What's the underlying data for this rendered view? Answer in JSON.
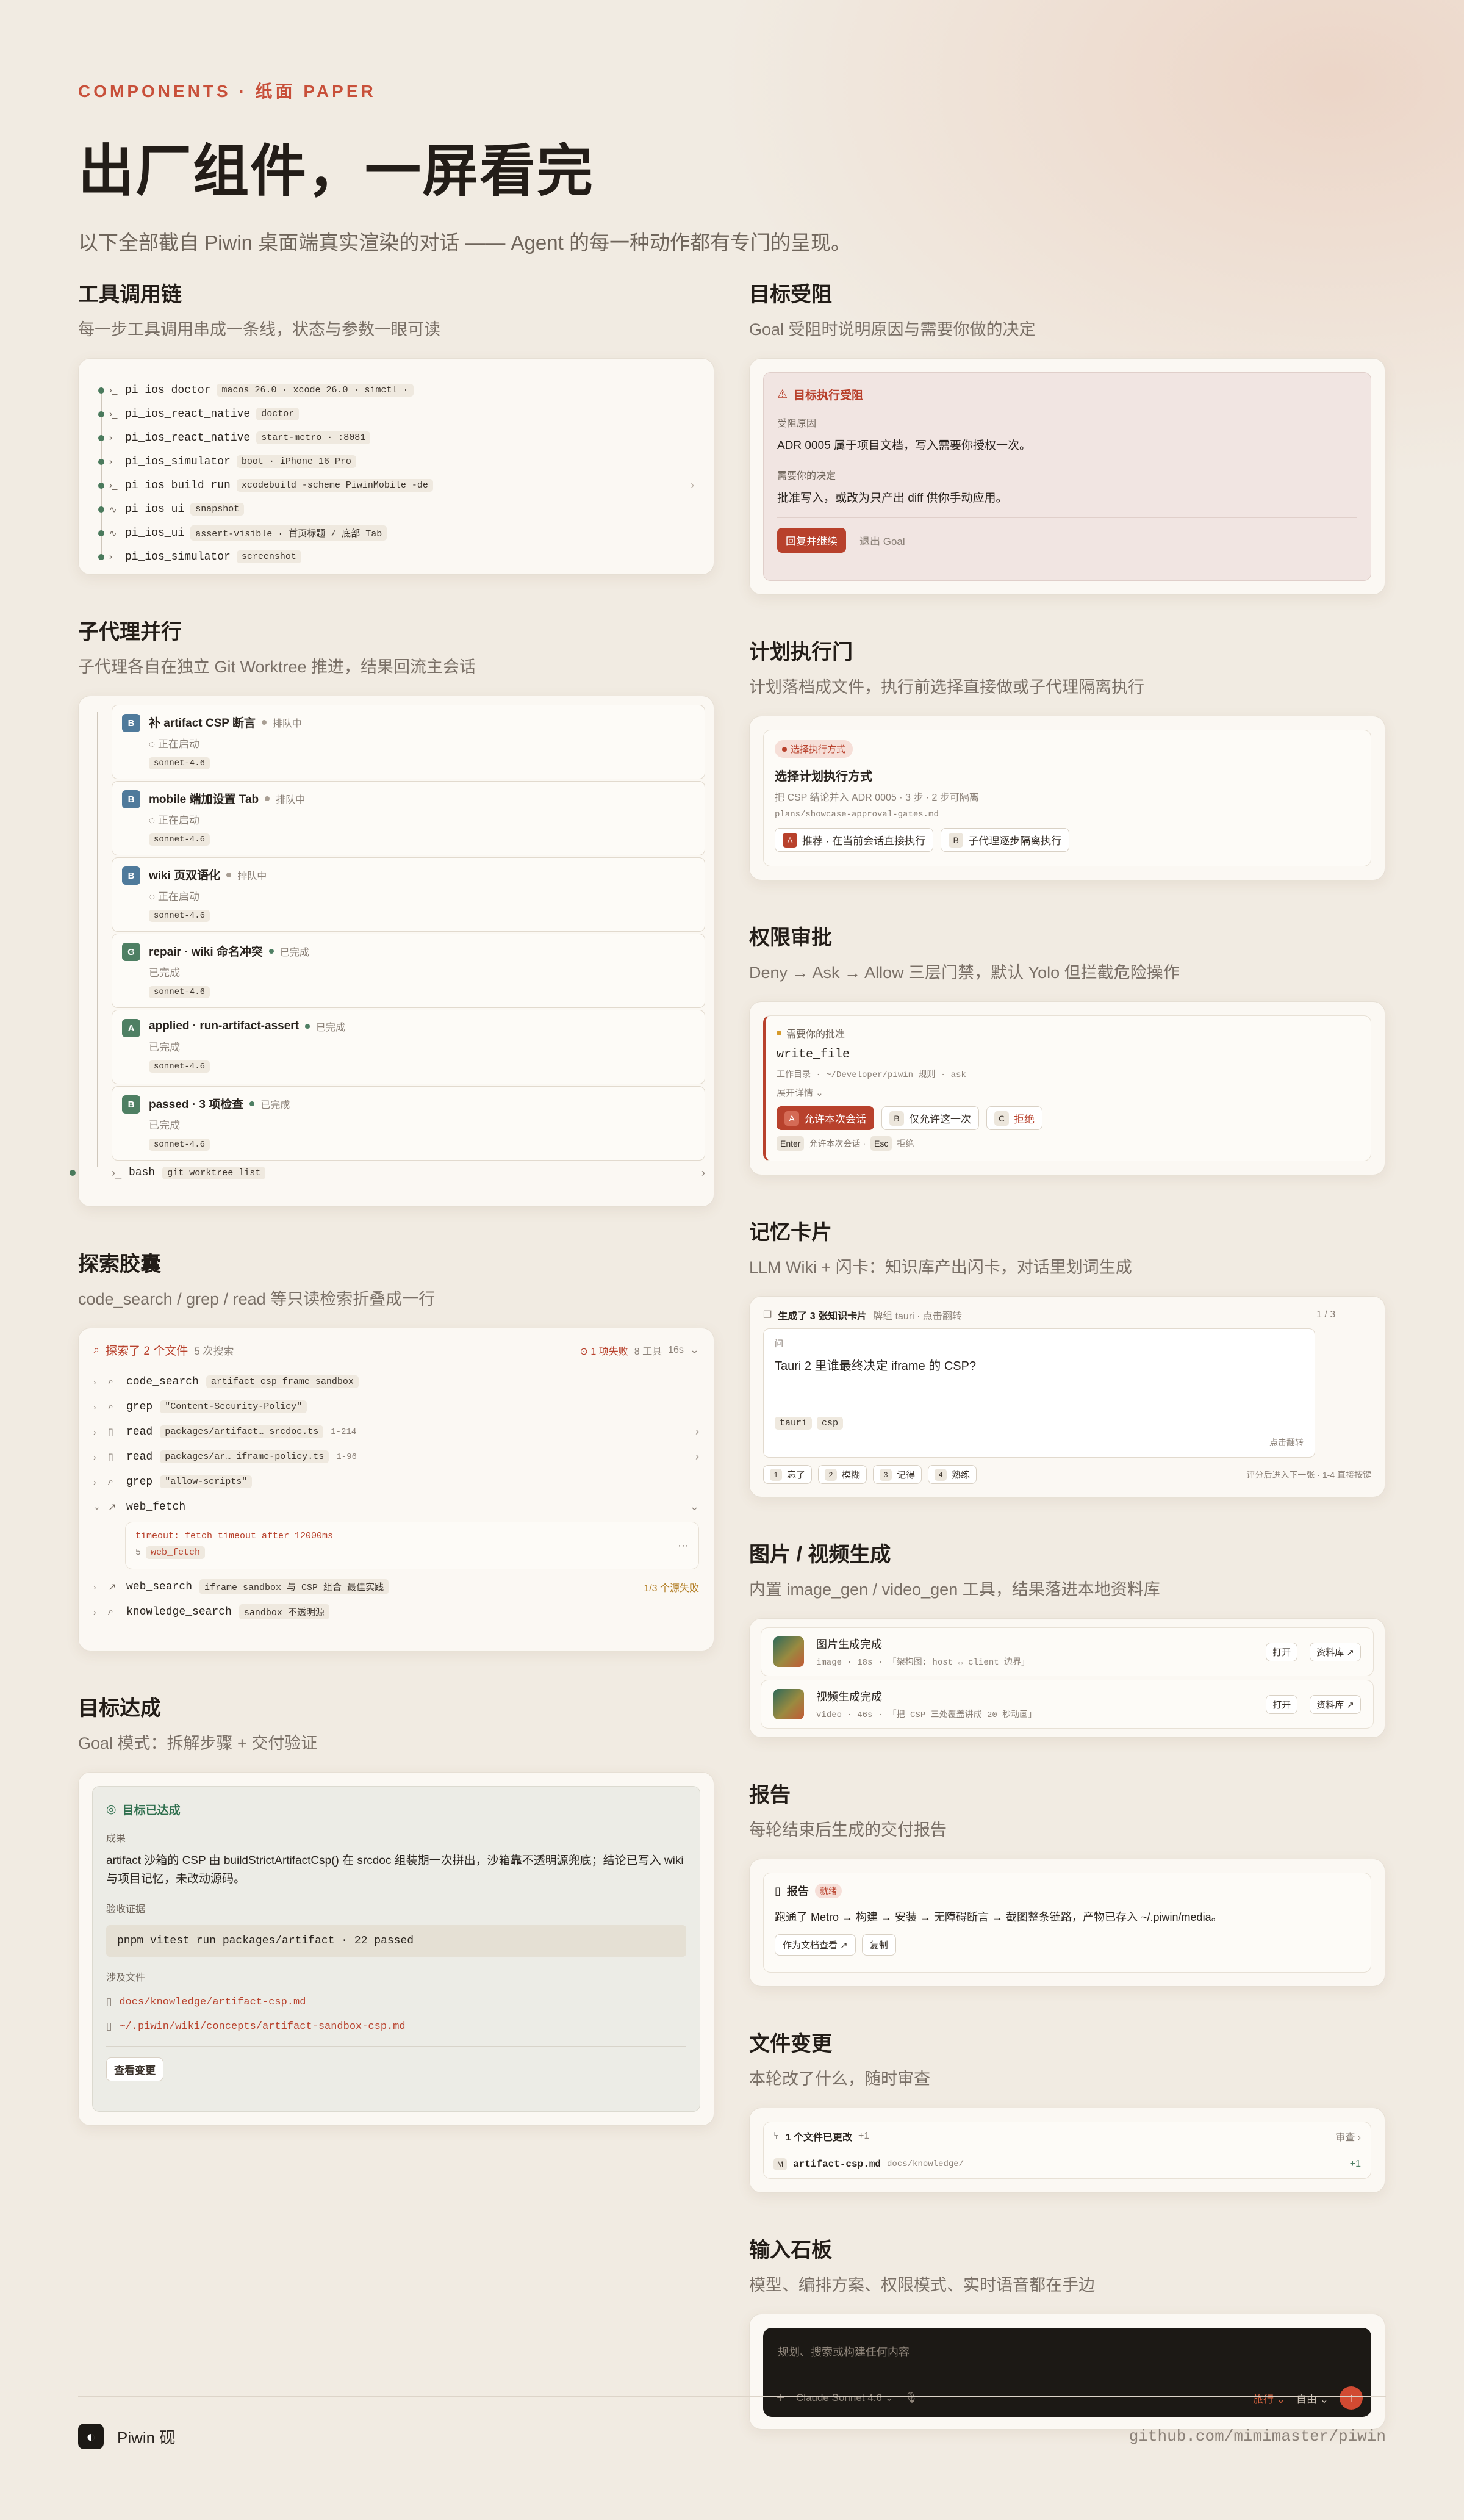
{
  "hero": {
    "eyebrow": "COMPONENTS · 纸面 PAPER",
    "title": "出厂组件，一屏看完",
    "subtitle": "以下全部截自 Piwin 桌面端真实渲染的对话 —— Agent 的每一种动作都有专门的呈现。"
  },
  "tool_chain": {
    "title": "工具调用链",
    "subtitle": "每一步工具调用串成一条线，状态与参数一眼可读",
    "rows": [
      {
        "icon": "terminal-icon",
        "glyph": "›_",
        "name": "pi_ios_doctor",
        "args": "macos 26.0 · xcode 26.0 · simctl ·"
      },
      {
        "icon": "terminal-icon",
        "glyph": "›_",
        "name": "pi_ios_react_native",
        "args": "doctor"
      },
      {
        "icon": "terminal-icon",
        "glyph": "›_",
        "name": "pi_ios_react_native",
        "args": "start-metro · :8081"
      },
      {
        "icon": "terminal-icon",
        "glyph": "›_",
        "name": "pi_ios_simulator",
        "args": "boot · iPhone 16 Pro"
      },
      {
        "icon": "terminal-icon",
        "glyph": "›_",
        "name": "pi_ios_build_run",
        "args": "xcodebuild -scheme PiwinMobile -de"
      },
      {
        "icon": "wave-icon",
        "glyph": "∿",
        "name": "pi_ios_ui",
        "args": "snapshot"
      },
      {
        "icon": "wave-icon",
        "glyph": "∿",
        "name": "pi_ios_ui",
        "args": "assert-visible · 首页标题 / 底部 Tab"
      },
      {
        "icon": "terminal-icon",
        "glyph": "›_",
        "name": "pi_ios_simulator",
        "args": "screenshot"
      }
    ]
  },
  "subagents": {
    "title": "子代理并行",
    "subtitle": "子代理各自在独立 Git Worktree 推进，结果回流主会话",
    "rows": [
      {
        "av": "B",
        "tone": "b",
        "name": "补 artifact CSP 断言",
        "state": "排队中",
        "detail": "◌ 正在启动",
        "model": "sonnet-4.6",
        "dot": "#a89e93"
      },
      {
        "av": "B",
        "tone": "b",
        "name": "mobile 端加设置 Tab",
        "state": "排队中",
        "detail": "◌ 正在启动",
        "model": "sonnet-4.6",
        "dot": "#a89e93"
      },
      {
        "av": "B",
        "tone": "b",
        "name": "wiki 页双语化",
        "state": "排队中",
        "detail": "◌ 正在启动",
        "model": "sonnet-4.6",
        "dot": "#a89e93"
      },
      {
        "av": "G",
        "tone": "g",
        "name": "repair · wiki 命名冲突",
        "state": "已完成",
        "detail": "已完成",
        "model": "sonnet-4.6",
        "dot": "#4e7f63"
      },
      {
        "av": "A",
        "tone": "g",
        "name": "applied · run-artifact-assert",
        "state": "已完成",
        "detail": "已完成",
        "model": "sonnet-4.6",
        "dot": "#4e7f63"
      },
      {
        "av": "B",
        "tone": "g",
        "name": "passed · 3 项检查",
        "state": "已完成",
        "detail": "已完成",
        "model": "sonnet-4.6",
        "dot": "#4e7f63"
      }
    ],
    "bash": {
      "name": "bash",
      "args": "git worktree list"
    }
  },
  "explore": {
    "title": "探索胶囊",
    "subtitle": "code_search / grep / read 等只读检索折叠成一行",
    "header": "探索了 2 个文件",
    "header_count": "5 次搜索",
    "failed": "1 项失败",
    "tools": "8 工具",
    "time": "16s",
    "rows": [
      {
        "icon": "search-icon",
        "glyph": "⌕",
        "name": "code_search",
        "args": "artifact csp frame sandbox",
        "range": ""
      },
      {
        "icon": "search-icon",
        "glyph": "⌕",
        "name": "grep",
        "args": "\"Content-Security-Policy\"",
        "range": ""
      },
      {
        "icon": "file-icon",
        "glyph": "▯",
        "name": "read",
        "args": "packages/artifact… srcdoc.ts",
        "range": "1-214"
      },
      {
        "icon": "file-icon",
        "glyph": "▯",
        "name": "read",
        "args": "packages/ar… iframe-policy.ts",
        "range": "1-96"
      },
      {
        "icon": "search-icon",
        "glyph": "⌕",
        "name": "grep",
        "args": "\"allow-scripts\"",
        "range": ""
      }
    ],
    "web_fetch": {
      "name": "web_fetch",
      "error": "timeout: fetch timeout after 12000ms",
      "num": "5",
      "tool": "web_fetch"
    },
    "web_search": {
      "name": "web_search",
      "args": "iframe sandbox 与 CSP 组合 最佳实践",
      "note": "1/3 个源失败"
    },
    "knowledge": {
      "name": "knowledge_search",
      "args": "sandbox 不透明源"
    }
  },
  "goal_done": {
    "title": "目标达成",
    "subtitle": "Goal 模式：拆解步骤 + 交付验证",
    "status": "目标已达成",
    "result_label": "成果",
    "result": "artifact 沙箱的 CSP 由 buildStrictArtifactCsp() 在 srcdoc 组装期一次拼出，沙箱靠不透明源兜底；结论已写入 wiki 与项目记忆，未改动源码。",
    "evidence_label": "验收证据",
    "evidence": "pnpm vitest run packages/artifact · 22 passed",
    "files_label": "涉及文件",
    "files": [
      "docs/knowledge/artifact-csp.md",
      "~/.piwin/wiki/concepts/artifact-sandbox-csp.md"
    ],
    "button": "查看变更"
  },
  "goal_blocked": {
    "title": "目标受阻",
    "subtitle": "Goal 受阻时说明原因与需要你做的决定",
    "status": "目标执行受阻",
    "reason_label": "受阻原因",
    "reason": "ADR 0005 属于项目文档，写入需要你授权一次。",
    "decision_label": "需要你的决定",
    "decision": "批准写入，或改为只产出 diff 供你手动应用。",
    "primary": "回复并继续",
    "secondary": "退出 Goal"
  },
  "plan_gate": {
    "title": "计划执行门",
    "subtitle": "计划落档成文件，执行前选择直接做或子代理隔离执行",
    "tag": "选择执行方式",
    "heading": "选择计划执行方式",
    "desc": "把 CSP 结论并入 ADR 0005 · 3 步 · 2 步可隔离",
    "path": "plans/showcase-approval-gates.md",
    "opt_a_key": "A",
    "opt_a": "推荐 · 在当前会话直接执行",
    "opt_b_key": "B",
    "opt_b": "子代理逐步隔离执行"
  },
  "permission": {
    "title": "权限审批",
    "subtitle": "Deny → Ask → Allow 三层门禁，默认 Yolo 但拦截危险操作",
    "label": "需要你的批准",
    "tool": "write_file",
    "meta": "工作目录 · ~/Developer/piwin  规则 · ask",
    "expand": "展开详情",
    "a_key": "A",
    "a": "允许本次会话",
    "b_key": "B",
    "b": "仅允许这一次",
    "c_key": "C",
    "c": "拒绝",
    "k1": "Enter",
    "k1_label": "允许本次会话 ·",
    "k2": "Esc",
    "k2_label": "拒绝"
  },
  "memory": {
    "title": "记忆卡片",
    "subtitle": "LLM Wiki + 闪卡：知识库产出闪卡，对话里划词生成",
    "header": "生成了 3 张知识卡片",
    "header_meta": "牌组 tauri · 点击翻转",
    "page": "1 / 3",
    "q_label": "问",
    "question": "Tauri 2 里谁最终决定 iframe 的 CSP?",
    "tags": [
      "tauri",
      "csp"
    ],
    "flip": "点击翻转",
    "grades": [
      {
        "k": "1",
        "l": "忘了"
      },
      {
        "k": "2",
        "l": "模糊"
      },
      {
        "k": "3",
        "l": "记得"
      },
      {
        "k": "4",
        "l": "熟练"
      }
    ],
    "hint": "评分后进入下一张 · 1-4 直接按键"
  },
  "media": {
    "title": "图片 / 视频生成",
    "subtitle": "内置 image_gen / video_gen 工具，结果落进本地资料库",
    "rows": [
      {
        "title": "图片生成完成",
        "meta": "image · 18s · 「架构图: host ↔ client 边界」",
        "open": "打开",
        "lib": "资料库 ↗"
      },
      {
        "title": "视频生成完成",
        "meta": "video · 46s · 「把 CSP 三处覆盖讲成 20 秒动画」",
        "open": "打开",
        "lib": "资料库 ↗"
      }
    ]
  },
  "report": {
    "title": "报告",
    "subtitle": "每轮结束后生成的交付报告",
    "label": "报告",
    "badge": "就绪",
    "text": "跑通了 Metro → 构建 → 安装 → 无障碍断言 → 截图整条链路，产物已存入 ~/.piwin/media。",
    "b1": "作为文档查看 ↗",
    "b2": "复制"
  },
  "changes": {
    "title": "文件变更",
    "subtitle": "本轮改了什么，随时审查",
    "header": "1 个文件已更改",
    "header_delta": "+1",
    "review": "审查 ›",
    "file_badge": "M",
    "file": "artifact-csp.md",
    "dir": "docs/knowledge/",
    "delta": "+1"
  },
  "composer": {
    "title": "输入石板",
    "subtitle": "模型、编排方案、权限模式、实时语音都在手边",
    "placeholder": "规划、搜索或构建任何内容",
    "model": "Claude Sonnet 4.6",
    "plan": "旅行",
    "mode": "自由"
  },
  "footer": {
    "brand": "Piwin 砚",
    "repo": "github.com/mimimaster/piwin"
  },
  "colors": {
    "accent": "#b8412c",
    "success": "#4e7f63",
    "background": "#f1ebe2"
  }
}
